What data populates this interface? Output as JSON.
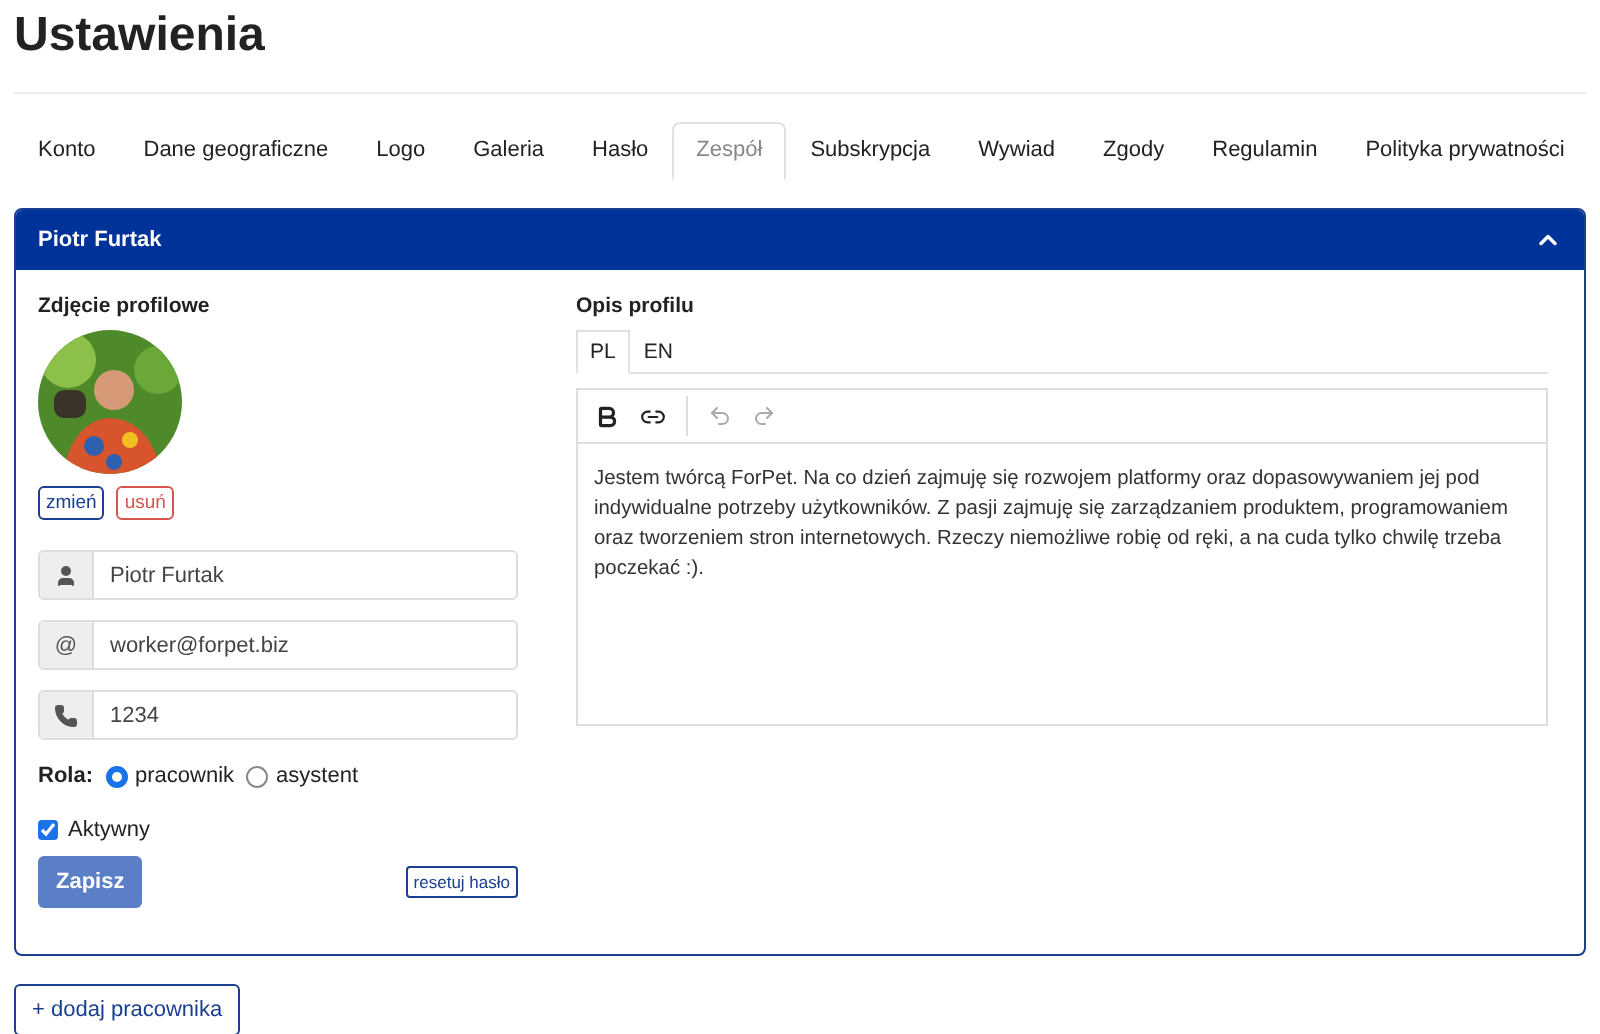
{
  "page_title": "Ustawienia",
  "tabs": [
    {
      "label": "Konto",
      "selected": false
    },
    {
      "label": "Dane geograficzne",
      "selected": false
    },
    {
      "label": "Logo",
      "selected": false
    },
    {
      "label": "Galeria",
      "selected": false
    },
    {
      "label": "Hasło",
      "selected": false
    },
    {
      "label": "Zespół",
      "selected": true
    },
    {
      "label": "Subskrypcja",
      "selected": false
    },
    {
      "label": "Wywiad",
      "selected": false
    },
    {
      "label": "Zgody",
      "selected": false
    },
    {
      "label": "Regulamin",
      "selected": false
    },
    {
      "label": "Polityka prywatności",
      "selected": false
    }
  ],
  "member": {
    "name": "Piotr Furtak",
    "expanded": true,
    "photo": {
      "heading": "Zdjęcie profilowe",
      "change": "zmień",
      "remove": "usuń"
    },
    "fields": [
      {
        "kind": "user",
        "value": "Piotr Furtak"
      },
      {
        "kind": "at",
        "symbol": "@",
        "value": "worker@forpet.biz"
      },
      {
        "kind": "phone",
        "value": "1234"
      }
    ],
    "role": {
      "label": "Rola:",
      "options": [
        {
          "label": "pracownik",
          "selected": true
        },
        {
          "label": "asystent",
          "selected": false
        }
      ]
    },
    "active": {
      "label": "Aktywny",
      "checked": true
    },
    "save": "Zapisz",
    "reset": "resetuj hasło",
    "description": {
      "heading": "Opis profilu",
      "langs": [
        {
          "label": "PL",
          "selected": true
        },
        {
          "label": "EN",
          "selected": false
        }
      ],
      "text": "Jestem twórcą ForPet. Na co dzień zajmuję się rozwojem platformy oraz dopasowywaniem jej pod indywidualne potrzeby użytkowników. Z pasji zajmuję się zarządzaniem produktem, programowaniem oraz tworzeniem stron internetowych. Rzeczy niemożliwe robię od ręki, a na cuda tylko chwilę trzeba poczekać :)."
    }
  },
  "add_button": "+ dodaj pracownika"
}
